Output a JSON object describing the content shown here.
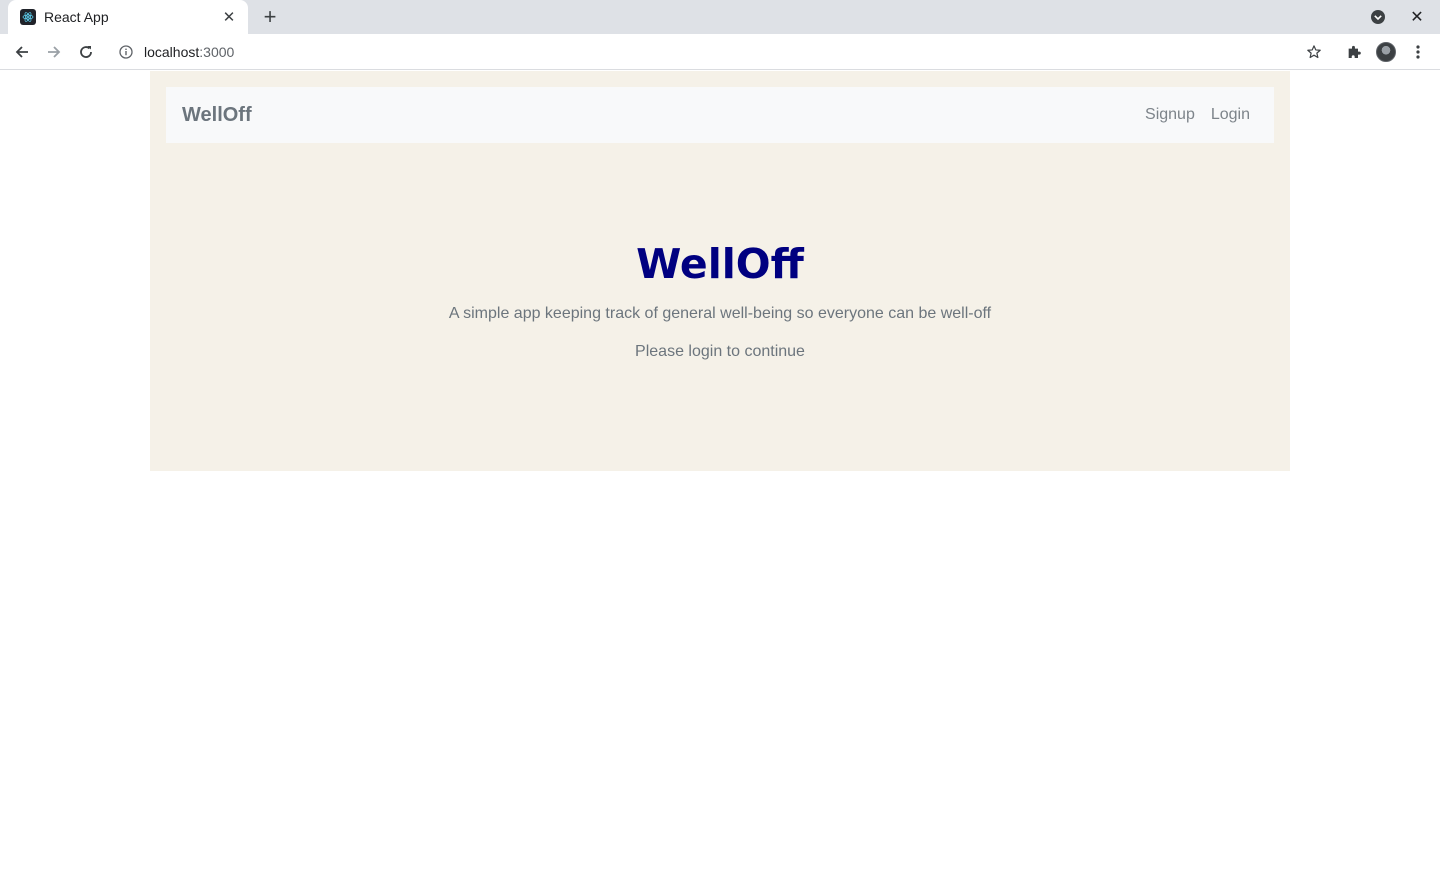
{
  "browser": {
    "tab": {
      "title": "React App"
    },
    "omnibox": {
      "host": "localhost",
      "port": ":3000"
    }
  },
  "navbar": {
    "brand": "WellOff",
    "links": [
      {
        "label": "Signup"
      },
      {
        "label": "Login"
      }
    ]
  },
  "hero": {
    "title": "WellOff",
    "subtitle": "A simple app keeping track of general well-being so everyone can be well-off",
    "cta": "Please login to continue"
  },
  "colors": {
    "page_background": "#f5f1e8",
    "navbar_background": "#f8f9fa",
    "title": "#000080",
    "muted_text": "#6c757d"
  }
}
